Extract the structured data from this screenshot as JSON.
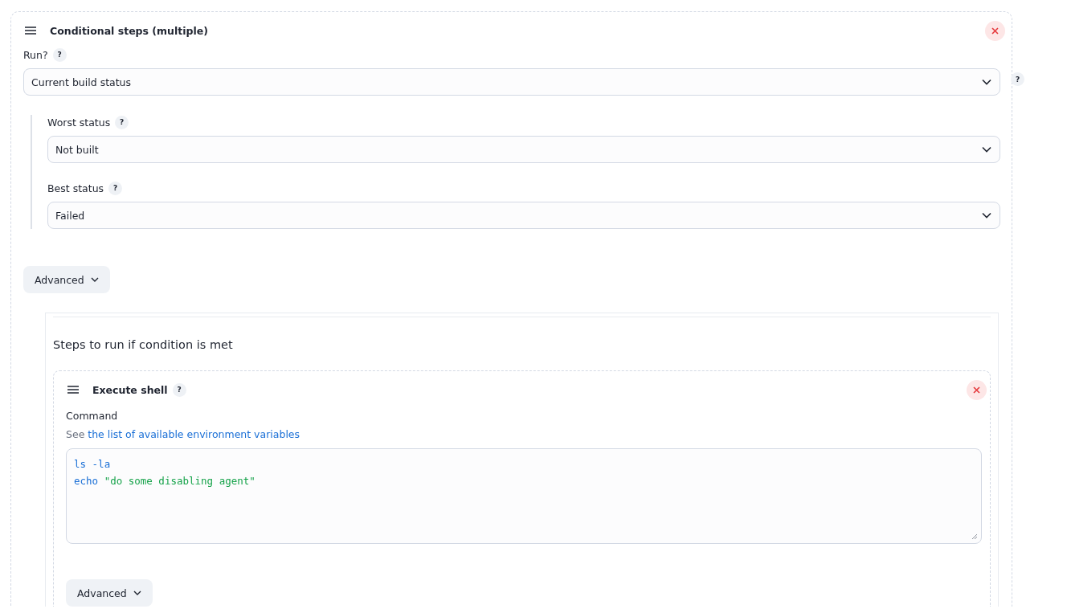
{
  "header": {
    "title": "Conditional steps (multiple)"
  },
  "run": {
    "label": "Run?",
    "help": "?",
    "value": "Current build status",
    "outer_help": "?"
  },
  "condition_fields": [
    {
      "label": "Worst status",
      "help": "?",
      "value": "Not built"
    },
    {
      "label": "Best status",
      "help": "?",
      "value": "Failed"
    }
  ],
  "advanced_button": {
    "label": "Advanced"
  },
  "steps_section": {
    "heading": "Steps to run if condition is met",
    "step": {
      "title": "Execute shell",
      "help": "?",
      "command_label": "Command",
      "hint_prefix": "See",
      "hint_link": "the list of available environment variables",
      "command_lines": [
        [
          {
            "text": "ls -la",
            "kind": "command"
          }
        ],
        [
          {
            "text": "echo ",
            "kind": "command"
          },
          {
            "text": "\"do some disabling agent\"",
            "kind": "string"
          }
        ]
      ],
      "advanced_button": {
        "label": "Advanced"
      }
    }
  }
}
